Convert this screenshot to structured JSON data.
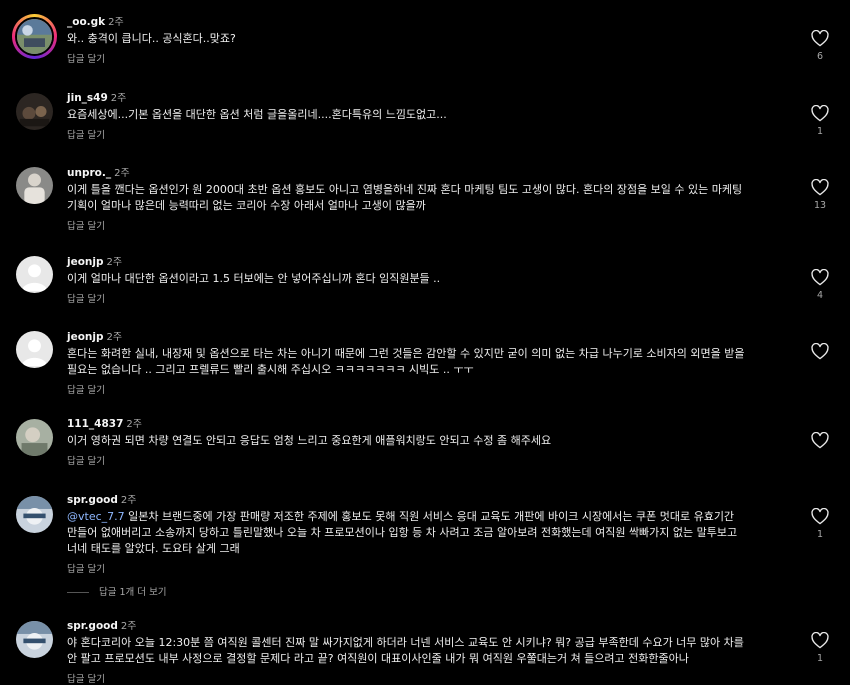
{
  "comments": [
    {
      "username": "_oo.gk",
      "time": "2주",
      "lines": [
        "와.. 충격이 큽니다.. 공식혼다..맞죠?"
      ],
      "reply_label": "답글 달기",
      "likes": "6"
    },
    {
      "username": "jin_s49",
      "time": "2주",
      "lines": [
        "요즘세상에...기본 옵션을 대단한 옵션 처럼 글을올리네....혼다특유의 느낌도없고..."
      ],
      "reply_label": "답글 달기",
      "likes": "1"
    },
    {
      "username": "unpro._",
      "time": "2주",
      "lines": [
        "이게 틀을 깬다는 옵션인가 원 2000대 초반 옵션 홍보도 아니고 염병을하네 진짜 혼다 마케팅 팀도 고생이 많다. 혼다의 장점을 보일 수 있는 마케팅",
        "기획이 얼마나 많은데 능력따리 없는 코리아 수장 아래서 얼마나 고생이 많을까"
      ],
      "reply_label": "답글 달기",
      "likes": "13"
    },
    {
      "username": "jeonjp",
      "time": "2주",
      "lines": [
        "이게 얼마나 대단한 옵션이라고 1.5 터보에는 안 넣어주십니까 혼다 임직원분들 .."
      ],
      "reply_label": "답글 달기",
      "likes": "4"
    },
    {
      "username": "jeonjp",
      "time": "2주",
      "lines": [
        "혼다는 화려한 실내, 내장재 및 옵션으로 타는 차는 아니기 때문에 그런 것들은 감안할 수 있지만 굳이 의미 없는 차급 나누기로 소비자의 외면을 받을",
        "필요는 없습니다 .. 그리고 프렐류드 빨리 출시해 주십시오 ㅋㅋㅋㅋㅋㅋㅋ 시빅도 .. ㅜㅜ"
      ],
      "reply_label": "답글 달기",
      "likes": ""
    },
    {
      "username": "111_4837",
      "time": "2주",
      "lines": [
        "이거 영하권 되면 차량 연결도 안되고 응답도 엄청 느리고 중요한게 애플워치랑도 안되고 수정 좀 해주세요"
      ],
      "reply_label": "답글 달기",
      "likes": ""
    },
    {
      "username": "spr.good",
      "time": "2주",
      "mention": "@vtec_7.7",
      "lines": [
        " 일본차 브랜드중에 가장 판매량 저조한 주제에 홍보도 못해 직원 서비스 응대 교육도 개판에 바이크 시장에서는 쿠폰 멋대로 유효기간",
        "만들어 없애버리고 소송까지 당하고 틀린말했나 오늘 차 프로모션이나 입항 등 차 사려고 조금 알아보려 전화했는데 여직원 싹빠가지 없는 말투보고",
        "너네 태도를 알았다. 도요타 살게 그래"
      ],
      "reply_label": "답글 달기",
      "likes": "1"
    },
    {
      "username": "spr.good",
      "time": "2주",
      "lines": [
        "야 혼다코리아 오늘 12:30분 쯤 여직원 콜센터 진짜 말 싸가지없게 하더라 너넨 서비스 교육도 안 시키냐? 뭐? 공급 부족한데 수요가 너무 많아 차를",
        "안 팔고 프로모션도 내부 사정으로 결정할 문제다 라고 끝? 여직원이 대표이사인줄 내가 뭐 여직원 우쭐대는거 쳐 들으려고 전화한줄아나"
      ],
      "reply_label": "답글 달기",
      "likes": "1"
    }
  ],
  "view_replies": "답글 1개 더 보기",
  "icons": {
    "like": "heart-outline-icon"
  },
  "colors": {
    "background": "#000000",
    "text": "#f5f5f5",
    "secondary": "#a8a8a8",
    "mention": "#8fb8ff"
  }
}
